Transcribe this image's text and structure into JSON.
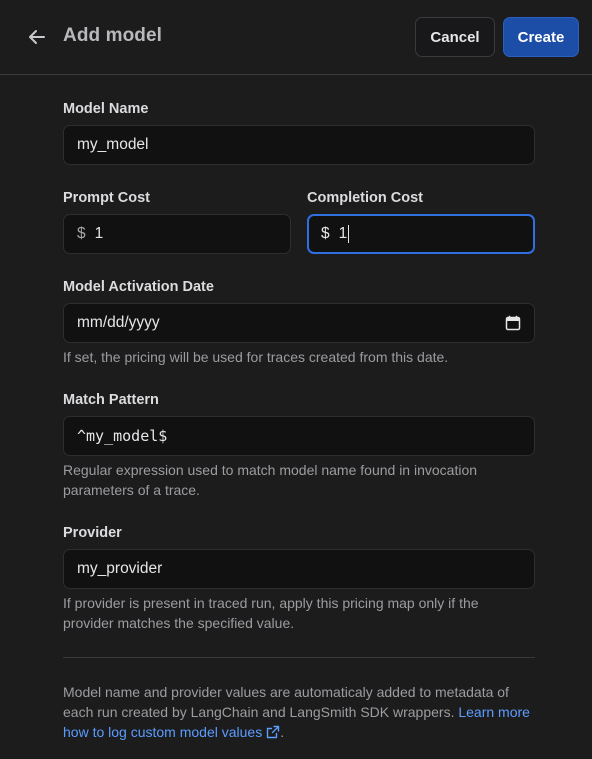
{
  "header": {
    "title": "Add model",
    "cancel_label": "Cancel",
    "create_label": "Create"
  },
  "form": {
    "model_name": {
      "label": "Model Name",
      "value": "my_model"
    },
    "prompt_cost": {
      "label": "Prompt Cost",
      "currency": "$",
      "value": "1"
    },
    "completion_cost": {
      "label": "Completion Cost",
      "currency": "$",
      "value": "1"
    },
    "activation_date": {
      "label": "Model Activation Date",
      "placeholder": "mm/dd/yyyy",
      "help": "If set, the pricing will be used for traces created from this date."
    },
    "match_pattern": {
      "label": "Match Pattern",
      "value": "^my_model$",
      "help": "Regular expression used to match model name found in invocation parameters of a trace."
    },
    "provider": {
      "label": "Provider",
      "value": "my_provider",
      "help": "If provider is present in traced run, apply this pricing map only if the provider matches the specified value."
    }
  },
  "footer": {
    "note": "Model name and provider values are automaticaly added to metadata of each run created by LangChain and LangSmith SDK wrappers. ",
    "link_text": "Learn more how to log custom model values",
    "end": "."
  },
  "colors": {
    "background": "#1c1c1d",
    "primary_button": "#1c4ea8",
    "focus_ring": "#2f6fe0",
    "link": "#5b9cff"
  },
  "icons": {
    "back": "arrow-left-icon",
    "calendar": "calendar-icon",
    "external": "external-link-icon"
  }
}
